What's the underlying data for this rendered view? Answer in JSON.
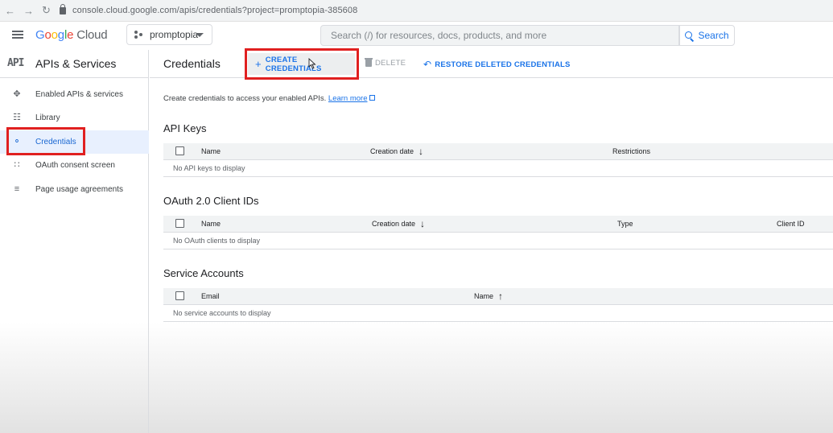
{
  "browser": {
    "url": "console.cloud.google.com/apis/credentials?project=promptopia-385608"
  },
  "header": {
    "logo_google": "Google",
    "logo_cloud": "Cloud",
    "project": "promptopia",
    "search_placeholder": "Search (/) for resources, docs, products, and more",
    "search_button": "Search"
  },
  "sidebar": {
    "badge": "API",
    "title": "APIs & Services",
    "items": [
      {
        "label": "Enabled APIs & services",
        "icon": "hub-icon"
      },
      {
        "label": "Library",
        "icon": "library-icon"
      },
      {
        "label": "Credentials",
        "icon": "key-icon",
        "active": true
      },
      {
        "label": "OAuth consent screen",
        "icon": "dots-grid-icon"
      },
      {
        "label": "Page usage agreements",
        "icon": "settings-list-icon"
      }
    ]
  },
  "main": {
    "title": "Credentials",
    "actions": {
      "create": "CREATE CREDENTIALS",
      "delete": "DELETE",
      "restore": "RESTORE DELETED CREDENTIALS"
    },
    "intro": "Create credentials to access your enabled APIs.",
    "learn_more": "Learn more",
    "api_keys": {
      "title": "API Keys",
      "columns": [
        "Name",
        "Creation date",
        "Restrictions"
      ],
      "empty": "No API keys to display"
    },
    "oauth": {
      "title": "OAuth 2.0 Client IDs",
      "columns": [
        "Name",
        "Creation date",
        "Type",
        "Client ID"
      ],
      "empty": "No OAuth clients to display"
    },
    "service_accounts": {
      "title": "Service Accounts",
      "columns": [
        "Email",
        "Name"
      ],
      "empty": "No service accounts to display"
    }
  },
  "colors": {
    "accent": "#1a73e8",
    "highlight": "#e02020",
    "active_bg": "#e8f0fe"
  }
}
